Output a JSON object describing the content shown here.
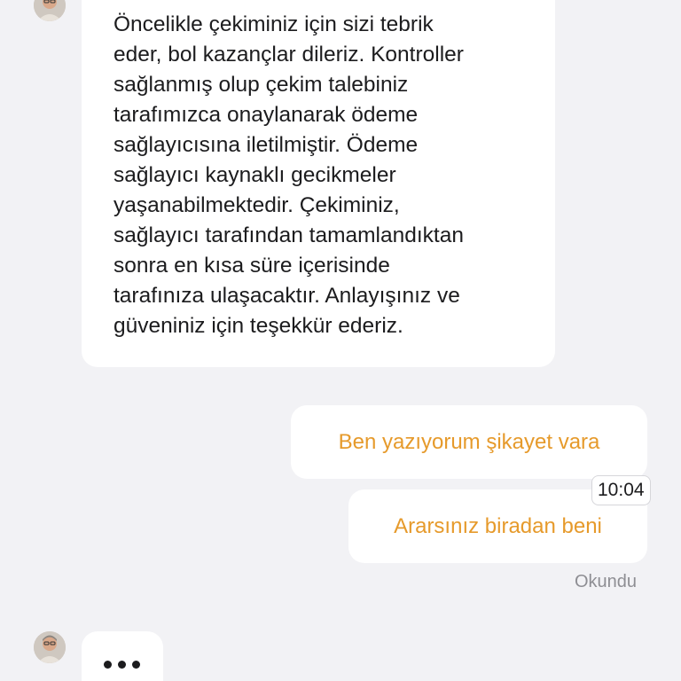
{
  "chat": {
    "agent_message": "Öncelikle çekiminiz için sizi tebrik\neder, bol kazançlar dileriz. Kontroller\nsağlanmış olup çekim talebiniz\ntarafımızca onaylanarak ödeme\nsağlayıcısına iletilmiştir. Ödeme\nsağlayıcı kaynaklı gecikmeler\nyaşanabilmektedir. Çekiminiz,\nsağlayıcı tarafından tamamlandıktan\nsonra en kısa süre içerisinde\ntarafınıza ulaşacaktır. Anlayışınız ve\ngüveniniz için teşekkür ederiz.",
    "user_messages": [
      "Ben yazıyorum şikayet vara",
      "Ararsınız biradan beni"
    ],
    "timestamp": "10:04",
    "read_status": "Okundu",
    "typing_indicator": "typing-dots-icon",
    "colors": {
      "user_text": "#e69a2b",
      "background": "#f2f2f5",
      "bubble": "#ffffff"
    }
  }
}
